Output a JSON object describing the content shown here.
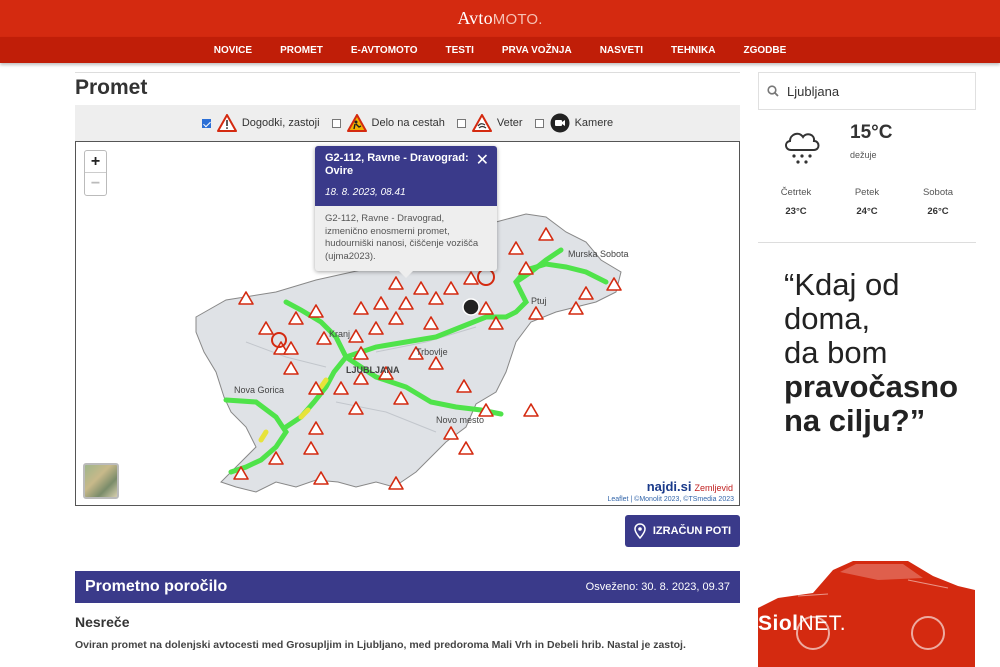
{
  "header": {
    "logo_part1": "Avto",
    "logo_part2": "MOTO.",
    "nav": [
      "NOVICE",
      "PROMET",
      "E-AVTOMOTO",
      "TESTI",
      "PRVA VOŽNJA",
      "NASVETI",
      "TEHNIKA",
      "ZGODBE"
    ],
    "brand_color": "#d42a10"
  },
  "main": {
    "title": "Promet",
    "filters": [
      {
        "label": "Dogodki, zastoji",
        "checked": true,
        "icon": "warning-triangle-icon"
      },
      {
        "label": "Delo na cestah",
        "checked": false,
        "icon": "roadwork-icon"
      },
      {
        "label": "Veter",
        "checked": false,
        "icon": "wind-warning-icon"
      },
      {
        "label": "Kamere",
        "checked": false,
        "icon": "camera-icon"
      }
    ],
    "map": {
      "zoom_in": "+",
      "zoom_out": "−",
      "popup": {
        "title": "G2-112, Ravne - Dravograd: Ovire",
        "date": "18. 8. 2023, 08.41",
        "body": "G2-112, Ravne - Dravograd, izmenično enosmerni promet, hudourniški nanosi, čiščenje vozišča (ujma2023)."
      },
      "place_labels": [
        "Murska Sobota",
        "Ptuj",
        "Kranj",
        "Trbovlje",
        "LJUBLJANA",
        "Nova Gorica",
        "Novo mesto"
      ],
      "brand": "najdi.si",
      "brand_sub": "Zemljevid",
      "attribution": "Leaflet | ©Monolit 2023, ©TSmedia 2023"
    },
    "route_button": "IZRAČUN POTI",
    "report": {
      "title": "Prometno poročilo",
      "updated": "Osveženo: 30. 8. 2023, 09.37",
      "section": "Nesreče",
      "text": "Oviran promet na dolenjski avtocesti med Grosupljim in Ljubljano, med predoroma Mali Vrh in Debeli hrib. Nastal je zastoj."
    },
    "accent_color": "#3a3a8a"
  },
  "sidebar": {
    "search_value": "Ljubljana",
    "weather": {
      "temp": "15°C",
      "desc": "dežuje",
      "icon": "rain-cloud-icon"
    },
    "forecast": [
      {
        "day": "Četrtek",
        "temp": "23°C"
      },
      {
        "day": "Petek",
        "temp": "24°C"
      },
      {
        "day": "Sobota",
        "temp": "26°C"
      }
    ],
    "ad": {
      "line1": "“Kdaj od",
      "line2": "doma,",
      "line3": "da bom",
      "line4": "pravočasno",
      "line5": "na cilju?”",
      "logo_a": "Siol",
      "logo_b": "NET."
    }
  }
}
